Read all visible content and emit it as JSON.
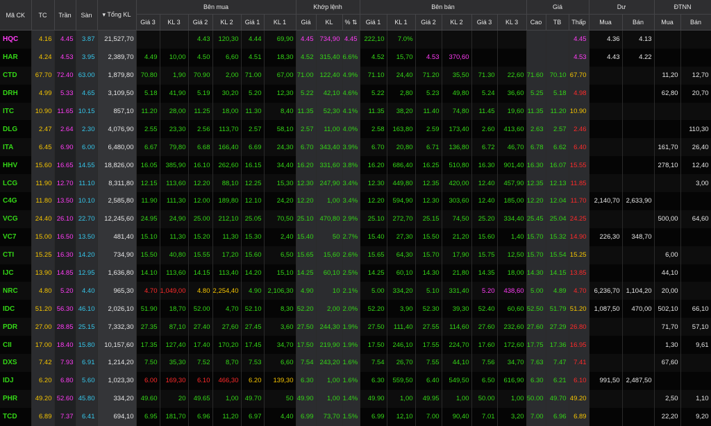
{
  "colors": {
    "up": "#34d616",
    "down": "#ff2a2a",
    "reference": "#f5c400",
    "ceiling": "#ff3cf5",
    "floor": "#35c6ea",
    "neutral": "#e6e6e6"
  },
  "header": {
    "symbol": "Mã CK",
    "ref": "TC",
    "ceiling": "Trần",
    "floor": "Sàn",
    "total_volume": "Tổng KL",
    "groups": {
      "buy": "Bên mua",
      "match": "Khớp lệnh",
      "sell": "Bên bán",
      "price": "Giá",
      "remain": "Dư",
      "foreign": "ĐTNN"
    },
    "buy_cols": [
      "Giá 3",
      "KL 3",
      "Giá 2",
      "KL 2",
      "Giá 1",
      "KL 1"
    ],
    "match_cols": [
      "Giá",
      "KL",
      "%"
    ],
    "sell_cols": [
      "Giá 1",
      "KL 1",
      "Giá 2",
      "KL 2",
      "Giá 3",
      "KL 3"
    ],
    "price_cols": [
      "Cao",
      "TB",
      "Thấp"
    ],
    "remain_cols": [
      "Mua",
      "Bán"
    ],
    "foreign_cols": [
      "Mua",
      "Bán"
    ]
  },
  "rows": [
    {
      "v": [
        "HQC",
        "4.16",
        "4.45",
        "3.87",
        "21,527,70",
        "",
        "",
        "4.43",
        "120,30",
        "4.44",
        "69,90",
        "4.45",
        "734,90",
        "4.45",
        "222,10",
        "7.0%",
        "",
        "",
        "",
        "",
        "",
        "",
        "4.45",
        "4.36",
        "4.13",
        "",
        "",
        "",
        "1,10"
      ],
      "c": "cwrcfwwuuuuccccccwwwwwwccud wwww"
    },
    {
      "v": [
        "HAR",
        "4.24",
        "4.53",
        "3.95",
        "2,389,70",
        "4.49",
        "10,00",
        "4.50",
        "6,60",
        "4.51",
        "18,30",
        "4.52",
        "315,40",
        "6.6%",
        "4.52",
        "15,70",
        "4.53",
        "370,60",
        "",
        "",
        "",
        "",
        "4.53",
        "4.43",
        "4.22",
        "",
        "",
        "77,10",
        "1,00"
      ],
      "c": "urcfwuuuuuuuuuuuucccwwwcudwwww"
    },
    {
      "v": [
        "CTD",
        "67.70",
        "72.40",
        "63.00",
        "1,879,80",
        "70.80",
        "1,90",
        "70.90",
        "2,00",
        "71.00",
        "67,00",
        "71.00",
        "122,40",
        "4.9%",
        "71.10",
        "24,40",
        "71.20",
        "35,50",
        "71.30",
        "22,60",
        "71.60",
        "70.10",
        "67.70",
        "",
        "",
        "11,20",
        "12,70"
      ],
      "c": "urcfwuuuuuuuuuuuuuuuuuuuurwwww"
    },
    {
      "v": [
        "DRH",
        "4.99",
        "5.33",
        "4.65",
        "3,109,50",
        "5.18",
        "41,90",
        "5.19",
        "30,20",
        "5.20",
        "12,30",
        "5.22",
        "42,10",
        "4.6%",
        "5.22",
        "2,80",
        "5.23",
        "49,80",
        "5.24",
        "36,60",
        "5.25",
        "5.18",
        "4.98",
        "",
        "",
        "62,80",
        "20,70"
      ],
      "c": "urcfwuuuuuuuuuuuuuuuuuuuudwwww"
    },
    {
      "v": [
        "ITC",
        "10.90",
        "11.65",
        "10.15",
        "857,10",
        "11.20",
        "28,00",
        "11.25",
        "18,00",
        "11.30",
        "8,40",
        "11.35",
        "52,30",
        "4.1%",
        "11.35",
        "38,20",
        "11.40",
        "74,80",
        "11.45",
        "19,60",
        "11.35",
        "11.20",
        "10.90",
        "",
        "",
        "",
        ""
      ],
      "c": "urcfwuuuuuuuuuuuuuuuuuuuurwwww"
    },
    {
      "v": [
        "DLG",
        "2.47",
        "2.64",
        "2.30",
        "4,076,90",
        "2.55",
        "23,30",
        "2.56",
        "113,70",
        "2.57",
        "58,10",
        "2.57",
        "11,00",
        "4.0%",
        "2.58",
        "163,80",
        "2.59",
        "173,40",
        "2.60",
        "413,60",
        "2.63",
        "2.57",
        "2.46",
        "",
        "",
        "",
        "110,30"
      ],
      "c": "urcfwuuuuuuuuuuuuuuuuuuuudwwww"
    },
    {
      "v": [
        "ITA",
        "6.45",
        "6.90",
        "6.00",
        "6,480,00",
        "6.67",
        "79,80",
        "6.68",
        "166,40",
        "6.69",
        "24,30",
        "6.70",
        "343,40",
        "3.9%",
        "6.70",
        "20,80",
        "6.71",
        "136,80",
        "6.72",
        "46,70",
        "6.78",
        "6.62",
        "6.40",
        "",
        "",
        "161,70",
        "26,40"
      ],
      "c": "urcfwuuuuuuuuuuuuuuuuuuuudwwww"
    },
    {
      "v": [
        "HHV",
        "15.60",
        "16.65",
        "14.55",
        "18,826,00",
        "16.05",
        "385,90",
        "16.10",
        "262,60",
        "16.15",
        "34,40",
        "16.20",
        "331,60",
        "3.8%",
        "16.20",
        "686,40",
        "16.25",
        "510,80",
        "16.30",
        "901,40",
        "16.30",
        "16.07",
        "15.55",
        "",
        "",
        "278,10",
        "12,40"
      ],
      "c": "urcfwuuuuuuuuuuuuuuuuuuuudwwww"
    },
    {
      "v": [
        "LCG",
        "11.90",
        "12.70",
        "11.10",
        "8,311,80",
        "12.15",
        "113,60",
        "12.20",
        "88,10",
        "12.25",
        "15,30",
        "12.30",
        "247,90",
        "3.4%",
        "12.30",
        "449,80",
        "12.35",
        "420,00",
        "12.40",
        "457,90",
        "12.35",
        "12.13",
        "11.85",
        "",
        "",
        "",
        "3,00"
      ],
      "c": "urcfwuuuuuuuuuuuuuuuuuuuudwwww"
    },
    {
      "v": [
        "C4G",
        "11.80",
        "13.50",
        "10.10",
        "2,585,80",
        "11.90",
        "111,30",
        "12.00",
        "189,80",
        "12.10",
        "24,20",
        "12.20",
        "1,00",
        "3.4%",
        "12.20",
        "594,90",
        "12.30",
        "303,60",
        "12.40",
        "185,00",
        "12.20",
        "12.04",
        "11.70",
        "2,140,70",
        "2,633,90",
        "",
        ""
      ],
      "c": "urcfwuuuuuuuuuuuuuuuuuuuudwwww"
    },
    {
      "v": [
        "VCG",
        "24.40",
        "26.10",
        "22.70",
        "12,245,60",
        "24.95",
        "24,90",
        "25.00",
        "212,10",
        "25.05",
        "70,50",
        "25.10",
        "470,80",
        "2.9%",
        "25.10",
        "272,70",
        "25.15",
        "74,50",
        "25.20",
        "334,40",
        "25.45",
        "25.04",
        "24.25",
        "",
        "",
        "500,00",
        "64,60"
      ],
      "c": "urcfwuuuuuuuuuuuuuuuuuuuudwwww"
    },
    {
      "v": [
        "VC7",
        "15.00",
        "16.50",
        "13.50",
        "481,40",
        "15.10",
        "11,30",
        "15.20",
        "11,30",
        "15.30",
        "2,40",
        "15.40",
        "50",
        "2.7%",
        "15.40",
        "27,30",
        "15.50",
        "21,20",
        "15.60",
        "1,40",
        "15.70",
        "15.32",
        "14.90",
        "226,30",
        "348,70",
        "",
        ""
      ],
      "c": "urcfwuuuuuuuuuuuuuuuuuuuudwwww"
    },
    {
      "v": [
        "CTI",
        "15.25",
        "16.30",
        "14.20",
        "734,90",
        "15.50",
        "40,80",
        "15.55",
        "17,20",
        "15.60",
        "6,50",
        "15.65",
        "15,60",
        "2.6%",
        "15.65",
        "64,30",
        "15.70",
        "17,90",
        "15.75",
        "12,50",
        "15.70",
        "15.54",
        "15.25",
        "",
        "",
        "6,00",
        ""
      ],
      "c": "urcfwuuuuuuuuuuuuuuuuuuuurwwww"
    },
    {
      "v": [
        "IJC",
        "13.90",
        "14.85",
        "12.95",
        "1,636,80",
        "14.10",
        "113,60",
        "14.15",
        "113,40",
        "14.20",
        "15,10",
        "14.25",
        "60,10",
        "2.5%",
        "14.25",
        "60,10",
        "14.30",
        "21,80",
        "14.35",
        "18,00",
        "14.30",
        "14.15",
        "13.85",
        "",
        "",
        "44,10",
        ""
      ],
      "c": "urcfwuuuuuuuuuuuuuuuuuuuudwwww"
    },
    {
      "v": [
        "NRC",
        "4.80",
        "5.20",
        "4.40",
        "965,30",
        "4.70",
        "1,049,00",
        "4.80",
        "2,254,40",
        "4.90",
        "2,106,30",
        "4.90",
        "10",
        "2.1%",
        "5.00",
        "334,20",
        "5.10",
        "331,40",
        "5.20",
        "438,60",
        "5.00",
        "4.89",
        "4.70",
        "6,236,70",
        "1,104,20",
        "20,00",
        ""
      ],
      "c": "rcfwddrruuuuuuuuuuuccuuddwwww"
    },
    {
      "v": [
        "IDC",
        "51.20",
        "56.30",
        "46.10",
        "2,026,10",
        "51.90",
        "18,70",
        "52.00",
        "4,70",
        "52.10",
        "8,30",
        "52.20",
        "2,00",
        "2.0%",
        "52.20",
        "3,90",
        "52.30",
        "39,30",
        "52.40",
        "60,60",
        "52.50",
        "51.79",
        "51.20",
        "1,087,50",
        "470,00",
        "502,10",
        "66,10"
      ],
      "c": "urcfwuuuuuuuuuuuuuuuuuuuurwwww"
    },
    {
      "v": [
        "PDR",
        "27.00",
        "28.85",
        "25.15",
        "7,332,30",
        "27.35",
        "87,10",
        "27.40",
        "27,60",
        "27.45",
        "3,60",
        "27.50",
        "244,30",
        "1.9%",
        "27.50",
        "111,40",
        "27.55",
        "114,60",
        "27.60",
        "232,60",
        "27.60",
        "27.29",
        "26.80",
        "",
        "",
        "71,70",
        "57,10"
      ],
      "c": "urcfwuuuuuuuuuuuuuuuuuuuudwwww"
    },
    {
      "v": [
        "CII",
        "17.00",
        "18.40",
        "15.80",
        "10,157,60",
        "17.35",
        "127,40",
        "17.40",
        "170,20",
        "17.45",
        "34,70",
        "17.50",
        "219,90",
        "1.9%",
        "17.50",
        "246,10",
        "17.55",
        "224,70",
        "17.60",
        "172,60",
        "17.75",
        "17.36",
        "16.95",
        "",
        "",
        "1,30",
        "9,61"
      ],
      "c": "urcfwuuuuuuuuuuuuuuuuuuuudwwww"
    },
    {
      "v": [
        "DXS",
        "7.42",
        "7.93",
        "6.91",
        "1,214,20",
        "7.50",
        "35,30",
        "7.52",
        "8,70",
        "7.53",
        "6,60",
        "7.54",
        "243,20",
        "1.6%",
        "7.54",
        "26,70",
        "7.55",
        "44,10",
        "7.56",
        "34,70",
        "7.63",
        "7.47",
        "7.41",
        "",
        "",
        "67,60",
        ""
      ],
      "c": "urcfwuuuuuuuuuuuuuuuuuuuudwwww"
    },
    {
      "v": [
        "IDJ",
        "6.20",
        "6.80",
        "5.60",
        "1,023,30",
        "6.00",
        "169,30",
        "6.10",
        "466,30",
        "6.20",
        "139,30",
        "6.30",
        "1,00",
        "1.6%",
        "6.30",
        "559,50",
        "6.40",
        "549,50",
        "6.50",
        "616,90",
        "6.30",
        "6.21",
        "6.10",
        "991,50",
        "2,487,50",
        "",
        ""
      ],
      "c": "urcfwddddrruuuuuuuuuuuuuudwwww"
    },
    {
      "v": [
        "PHR",
        "49.20",
        "52.60",
        "45.80",
        "334,20",
        "49.60",
        "20",
        "49.65",
        "1,00",
        "49.70",
        "50",
        "49.90",
        "1,00",
        "1.4%",
        "49.90",
        "1,00",
        "49.95",
        "1,00",
        "50.00",
        "1,00",
        "50.00",
        "49.70",
        "49.20",
        "",
        "",
        "2,50",
        "1,10"
      ],
      "c": "urcfwuuuuuuuuuuuuuuuuuuuurwwww"
    },
    {
      "v": [
        "TCD",
        "6.89",
        "7.37",
        "6.41",
        "694,10",
        "6.95",
        "181,70",
        "6.96",
        "11,20",
        "6.97",
        "4,40",
        "6.99",
        "73,70",
        "1.5%",
        "6.99",
        "12,10",
        "7.00",
        "90,40",
        "7.01",
        "3,20",
        "7.00",
        "6.96",
        "6.89",
        "",
        "",
        "22,20",
        "9,20"
      ],
      "c": "urcfwuuuuuuuuuuuuuuuuuuuurwwww"
    }
  ]
}
